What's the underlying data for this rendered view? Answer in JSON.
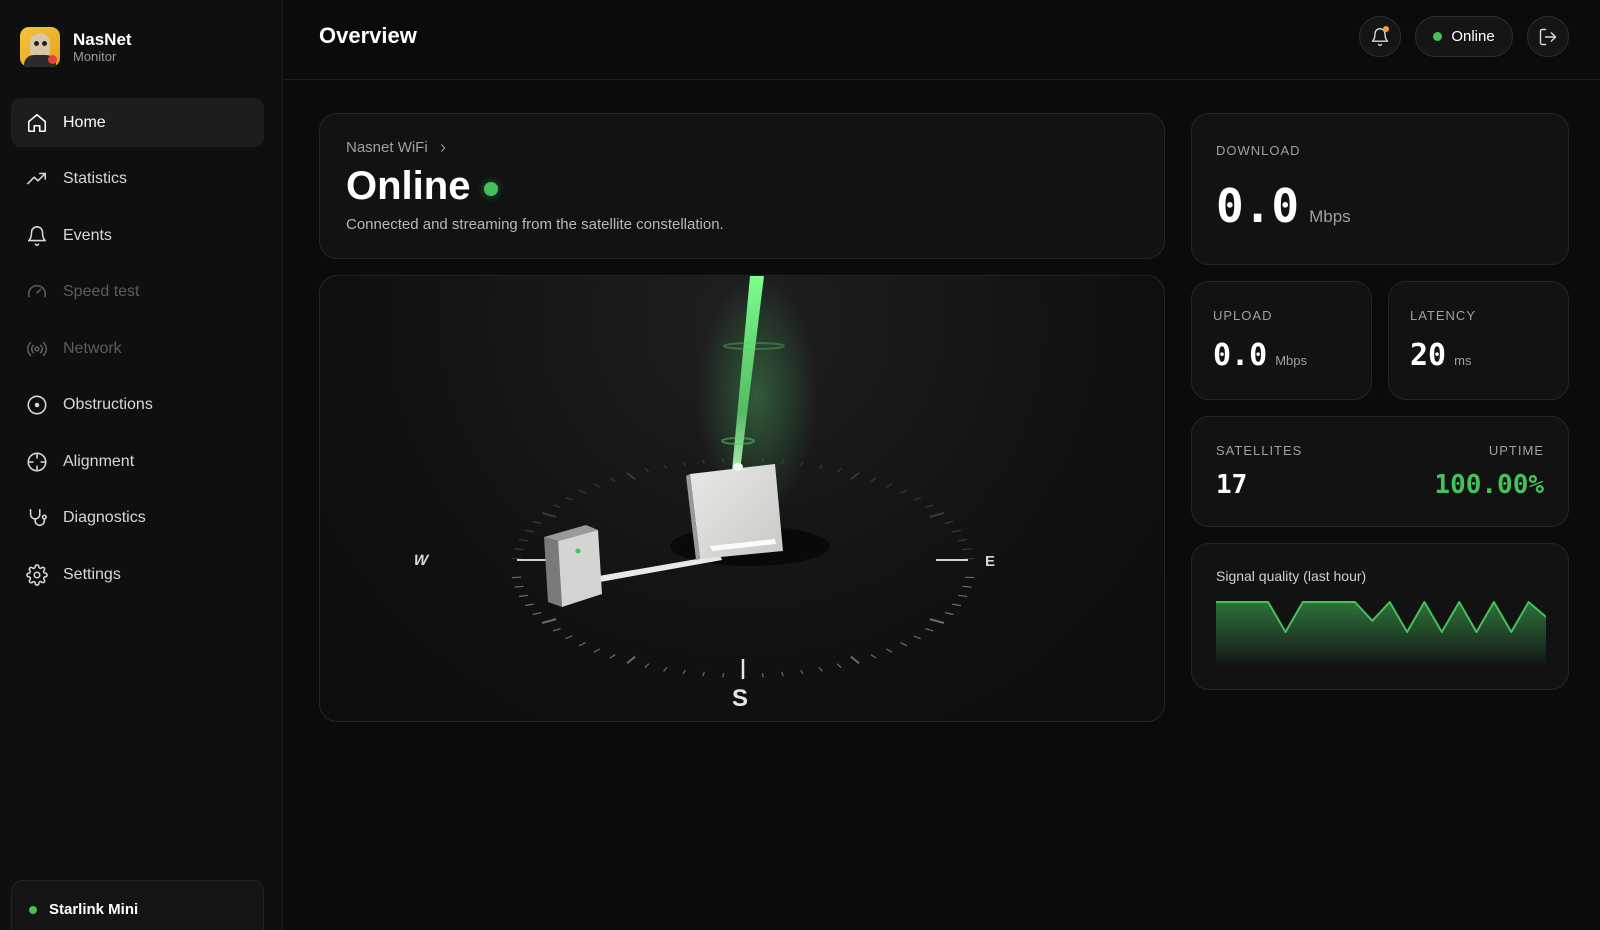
{
  "brand": {
    "name": "NasNet",
    "subtitle": "Monitor"
  },
  "sidebar": {
    "items": [
      {
        "label": "Home",
        "icon": "home-icon",
        "active": true
      },
      {
        "label": "Statistics",
        "icon": "trend-icon"
      },
      {
        "label": "Events",
        "icon": "bell-icon"
      },
      {
        "label": "Speed test",
        "icon": "gauge-icon",
        "disabled": true
      },
      {
        "label": "Network",
        "icon": "broadcast-icon",
        "disabled": true
      },
      {
        "label": "Obstructions",
        "icon": "target-icon"
      },
      {
        "label": "Alignment",
        "icon": "crosshair-icon"
      },
      {
        "label": "Diagnostics",
        "icon": "stethoscope-icon"
      },
      {
        "label": "Settings",
        "icon": "gear-icon"
      }
    ],
    "device": {
      "label": "Starlink Mini",
      "status_color": "#44c15a"
    }
  },
  "header": {
    "title": "Overview",
    "status_label": "Online",
    "status_color": "#44c15a",
    "notification_badge_color": "#f0a23a"
  },
  "status_card": {
    "network_name": "Nasnet WiFi",
    "status": "Online",
    "description": "Connected and streaming from the satellite constellation."
  },
  "compass": {
    "west": "W",
    "east": "E",
    "south": "S"
  },
  "metrics": {
    "download": {
      "label": "DOWNLOAD",
      "value": "0.0",
      "unit": "Mbps"
    },
    "upload": {
      "label": "UPLOAD",
      "value": "0.0",
      "unit": "Mbps"
    },
    "latency": {
      "label": "LATENCY",
      "value": "20",
      "unit": "ms"
    },
    "satellites": {
      "label": "SATELLITES",
      "value": "17"
    },
    "uptime": {
      "label": "UPTIME",
      "value": "100.00%"
    }
  },
  "signal": {
    "title": "Signal quality (last hour)",
    "accent_color": "#44c15a",
    "values": [
      100,
      100,
      100,
      100,
      60,
      100,
      100,
      100,
      100,
      75,
      100,
      60,
      100,
      60,
      100,
      60,
      100,
      60,
      100,
      80
    ]
  }
}
